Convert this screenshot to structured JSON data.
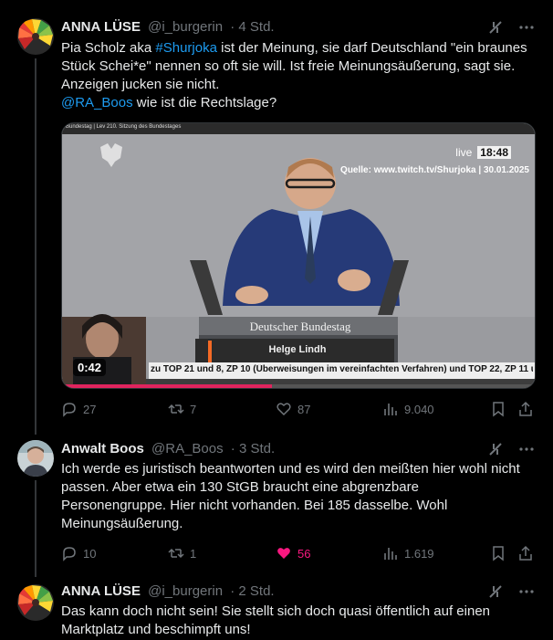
{
  "posts": [
    {
      "name": "ANNA LÜSE",
      "handle": "@i_burgerin",
      "time": "· 4 Std.",
      "text_part1": "Pia Scholz aka ",
      "hashtag": "#Shurjoka",
      "text_part2": " ist der Meinung, sie darf Deutschland \"ein braunes Stück Schei*e\" nennen so oft sie will. Ist freie Meinungsäußerung, sagt sie. Anzeigen jucken sie nicht.",
      "mention": "@RA_Boos",
      "text_part3": " wie ist die Rechtslage?",
      "replies": "27",
      "reposts": "7",
      "likes": "87",
      "views": "9.040"
    },
    {
      "name": "Anwalt Boos",
      "handle": "@RA_Boos",
      "time": "· 3 Std.",
      "text": "Ich werde es juristisch beantworten und es wird den meißten hier wohl nicht passen. Aber etwa ein 130 StGB braucht eine abgrenzbare Personengruppe. Hier nicht vorhanden. Bei 185 dasselbe. Wohl Meinungsäußerung.",
      "replies": "10",
      "reposts": "1",
      "likes": "56",
      "views": "1.619"
    },
    {
      "name": "ANNA LÜSE",
      "handle": "@i_burgerin",
      "time": "· 2 Std.",
      "text": "Das kann doch nicht sein! Sie stellt sich doch quasi öffentlich auf einen Marktplatz und beschimpft uns!"
    }
  ],
  "video": {
    "topbar_left": "Bundestag | Lev 210. Sitzung des Bundestages",
    "live_label": "live",
    "clock": "18:48",
    "source": "Quelle: www.twitch.tv/Shurjoka | 30.01.2025",
    "podium_label": "Deutscher Bundestag",
    "speaker": "Helge Lindh",
    "ticker": "zu TOP 21 und 8, ZP 10 (Überweisungen im vereinfachten Verfahren) und TOP 22, ZP 11 u",
    "duration": "0:42"
  },
  "colors": {
    "link": "#1d9bf0",
    "like_active": "#f91880",
    "muted": "#71767b"
  }
}
